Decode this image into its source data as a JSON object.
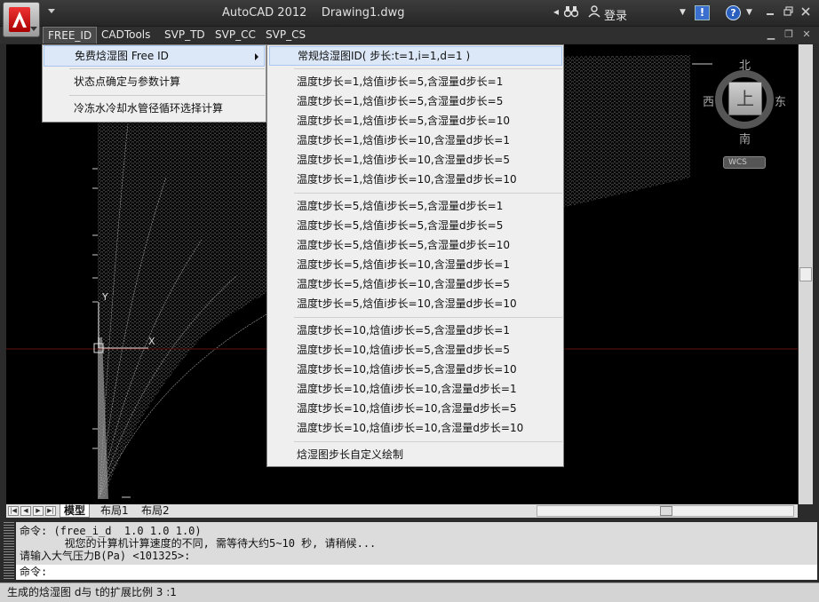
{
  "title_bar": {
    "app_name": "AutoCAD 2012",
    "document": "Drawing1.dwg",
    "login_label": "登录",
    "info_label": "!",
    "help_label": "?"
  },
  "menubar": {
    "items": [
      "FREE_ID",
      "CADTools",
      "SVP_TD",
      "SVP_CC",
      "SVP_CS"
    ]
  },
  "menu_free_id": {
    "items": [
      "免费焓湿图  Free ID",
      "状态点确定与参数计算",
      "冷冻水冷却水管径循环选择计算"
    ]
  },
  "submenu_free_id": {
    "header": "常规焓湿图ID( 步长:t=1,i=1,d=1 )",
    "group1": [
      "温度t步长=1,焓值i步长=5,含湿量d步长=1",
      "温度t步长=1,焓值i步长=5,含湿量d步长=5",
      "温度t步长=1,焓值i步长=5,含湿量d步长=10",
      "温度t步长=1,焓值i步长=10,含湿量d步长=1",
      "温度t步长=1,焓值i步长=10,含湿量d步长=5",
      "温度t步长=1,焓值i步长=10,含湿量d步长=10"
    ],
    "group2": [
      "温度t步长=5,焓值i步长=5,含湿量d步长=1",
      "温度t步长=5,焓值i步长=5,含湿量d步长=5",
      "温度t步长=5,焓值i步长=5,含湿量d步长=10",
      "温度t步长=5,焓值i步长=10,含湿量d步长=1",
      "温度t步长=5,焓值i步长=10,含湿量d步长=5",
      "温度t步长=5,焓值i步长=10,含湿量d步长=10"
    ],
    "group3": [
      "温度t步长=10,焓值i步长=5,含湿量d步长=1",
      "温度t步长=10,焓值i步长=5,含湿量d步长=5",
      "温度t步长=10,焓值i步长=5,含湿量d步长=10",
      "温度t步长=10,焓值i步长=10,含湿量d步长=1",
      "温度t步长=10,焓值i步长=10,含湿量d步长=5",
      "温度t步长=10,焓值i步长=10,含湿量d步长=10"
    ],
    "footer": "焓湿图步长自定义绘制"
  },
  "viewcube": {
    "north": "北",
    "south": "南",
    "east": "东",
    "west": "西",
    "top": "上",
    "wcs": "WCS"
  },
  "ucs": {
    "y_label": "Y",
    "x_label": "X"
  },
  "tabs": {
    "nav": [
      "|◀",
      "◀",
      "▶",
      "▶|"
    ],
    "items": [
      "模型",
      "布局1",
      "布局2"
    ]
  },
  "command": {
    "history": [
      "命令: (free_i_d  1.0 1.0 1.0)",
      "       视您的计算机计算速度的不同, 需等待大约5~10 秒, 请稍候...",
      "请输入大气压力B(Pa) <101325>:"
    ],
    "prompt": "命令:"
  },
  "status_bar": {
    "text": "生成的焓湿图 d与 t的扩展比例 3 :1"
  },
  "colors": {
    "canvas": "#000000",
    "menu_bg": "#efefef",
    "highlight": "#dce8f7",
    "accent_red": "#cc2222"
  }
}
